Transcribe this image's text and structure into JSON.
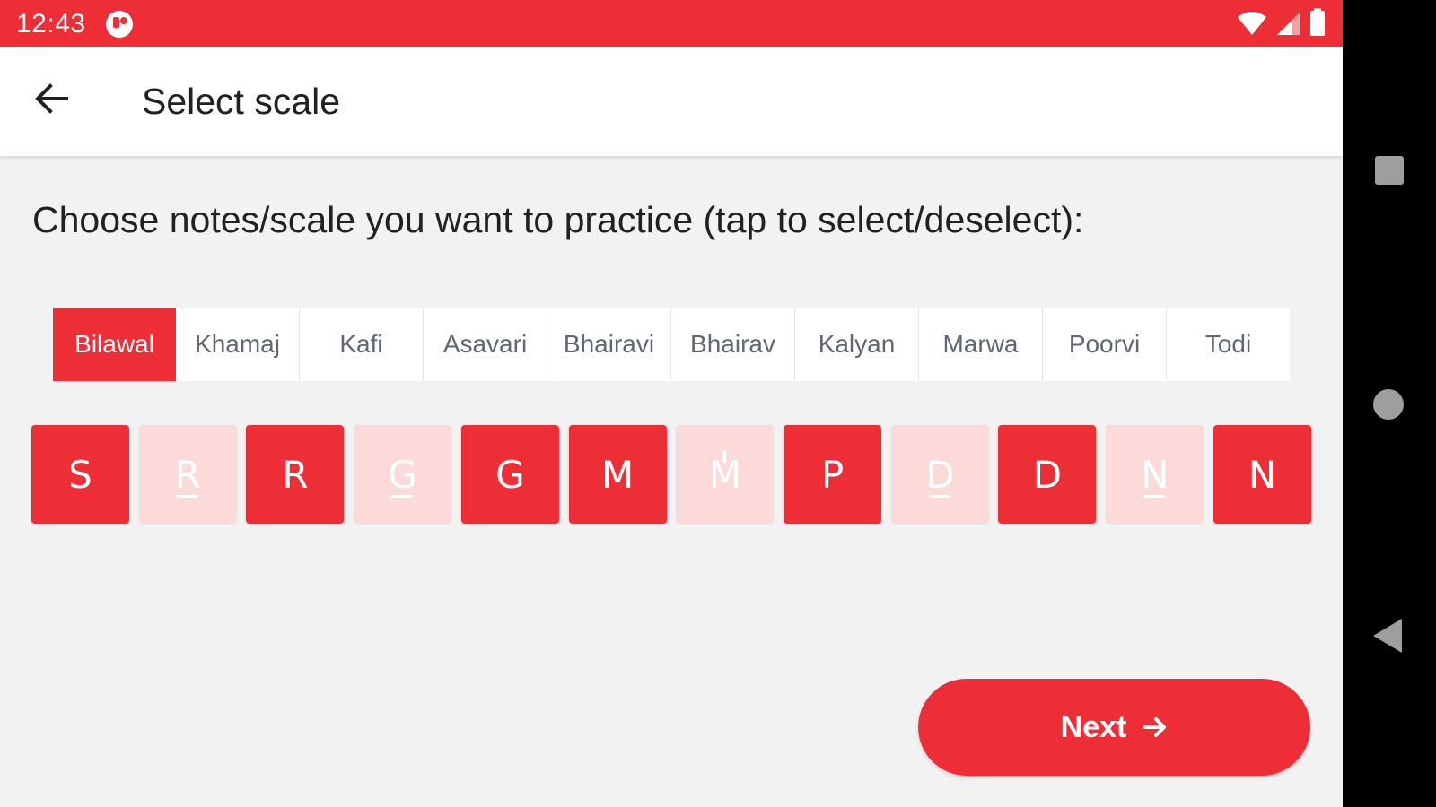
{
  "status_bar": {
    "time": "12:43",
    "icons": [
      "app-notification-icon",
      "wifi-icon",
      "signal-icon",
      "battery-icon"
    ]
  },
  "app_bar": {
    "back_icon": "arrow-left-icon",
    "title": "Select scale"
  },
  "instruction": "Choose notes/scale you want to practice (tap to select/deselect):",
  "scales": {
    "selected": "Bilawal",
    "items": [
      {
        "label": "Bilawal"
      },
      {
        "label": "Khamaj"
      },
      {
        "label": "Kafi"
      },
      {
        "label": "Asavari"
      },
      {
        "label": "Bhairavi"
      },
      {
        "label": "Bhairav"
      },
      {
        "label": "Kalyan"
      },
      {
        "label": "Marwa"
      },
      {
        "label": "Poorvi"
      },
      {
        "label": "Todi"
      }
    ]
  },
  "notes": [
    {
      "label": "S",
      "selected": true
    },
    {
      "label": "R",
      "selected": false,
      "variant": "komal"
    },
    {
      "label": "R",
      "selected": true
    },
    {
      "label": "G",
      "selected": false,
      "variant": "komal"
    },
    {
      "label": "G",
      "selected": true
    },
    {
      "label": "M",
      "selected": true
    },
    {
      "label": "M",
      "selected": false,
      "variant": "tivra"
    },
    {
      "label": "P",
      "selected": true
    },
    {
      "label": "D",
      "selected": false,
      "variant": "komal"
    },
    {
      "label": "D",
      "selected": true
    },
    {
      "label": "N",
      "selected": false,
      "variant": "komal"
    },
    {
      "label": "N",
      "selected": true
    }
  ],
  "next_button": {
    "label": "Next",
    "icon": "arrow-right-icon"
  },
  "nav_bar": {
    "icons": [
      "recents-square-icon",
      "home-circle-icon",
      "back-triangle-icon"
    ]
  },
  "colors": {
    "accent": "#ee2e36",
    "accent_light": "#fcdada",
    "background": "#f2f2f2",
    "tab_text": "#606673"
  }
}
